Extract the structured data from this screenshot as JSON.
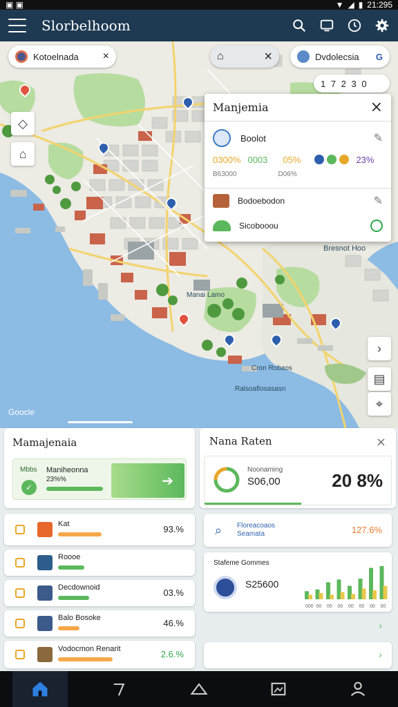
{
  "status": {
    "time": "21:295"
  },
  "app": {
    "title": "Slorbelhoom"
  },
  "map": {
    "chip_left": "Kotoelnada",
    "chip_right": "Dvdolecsia",
    "counter": "1 7  2 3  0",
    "label_east": "Bresnot Hoo",
    "label_park": "Manai Lamo",
    "label_dock": "Cron Robaos",
    "label_pier": "Ralsoaflosasasn",
    "google": "Goocle"
  },
  "popup": {
    "title": "Manjemia",
    "item1_name": "Boolot",
    "stat_a": "0300%",
    "stat_b": "0003",
    "stat_c": "05%",
    "stat_d": "23%",
    "sub_a": "B63000",
    "sub_b": "D06%",
    "item2_name": "Bodoebodon",
    "item3_name": "Sicobooou"
  },
  "left_panel": {
    "title": "Mamajenaia",
    "hero_tag": "Mbbs",
    "hero_name": "Maniheonna",
    "hero_value": "23%%",
    "rows": [
      {
        "name": "Kat",
        "value": "93.%",
        "color": "#e8672a",
        "bar": 0.7,
        "barcolor": "#f5a74a"
      },
      {
        "name": "Roooe",
        "value": "",
        "color": "#2d5d8a",
        "bar": 0.42,
        "barcolor": "#5cb85c"
      },
      {
        "name": "Decdownoid",
        "value": "03.%",
        "color": "#3c5a8a",
        "bar": 0.5,
        "barcolor": "#5cb85c"
      },
      {
        "name": "Balo Bosoke",
        "value": "46.%",
        "color": "#3c5a8a",
        "bar": 0.35,
        "barcolor": "#f5a74a"
      },
      {
        "name": "Vodocmon Renarit",
        "value": "2.6.%",
        "color": "#8a6a3c",
        "bar": 0.88,
        "barcolor": "#f5a74a"
      }
    ]
  },
  "right_panel": {
    "title": "Nana Raten",
    "gauge_label": "Noonaming",
    "gauge_value": "S06,00",
    "big_pct": "20 8%",
    "alert_title": "Floreacoaos",
    "alert_sub": "Seamata",
    "alert_value": "127.6%",
    "chart_title": "Stafeme Gommes",
    "chart_value": "S25600",
    "chart_ticks": [
      "000",
      "00",
      "00",
      "00",
      "00",
      "00",
      "00",
      "00"
    ]
  },
  "colors": {
    "accent": "#1e3a52",
    "green": "#5cb85c",
    "orange": "#f5a74a",
    "water": "#8cbbe4"
  },
  "chart_data": {
    "type": "bar",
    "categories": [
      "000",
      "00",
      "00",
      "00",
      "00",
      "00",
      "00",
      "00"
    ],
    "series": [
      {
        "values": [
          18,
          22,
          38,
          44,
          30,
          46,
          70,
          74
        ]
      },
      {
        "values": [
          10,
          14,
          10,
          16,
          12,
          24,
          20,
          30
        ]
      }
    ],
    "title": "Stafeme Gommes",
    "ylim": [
      0,
      80
    ]
  }
}
